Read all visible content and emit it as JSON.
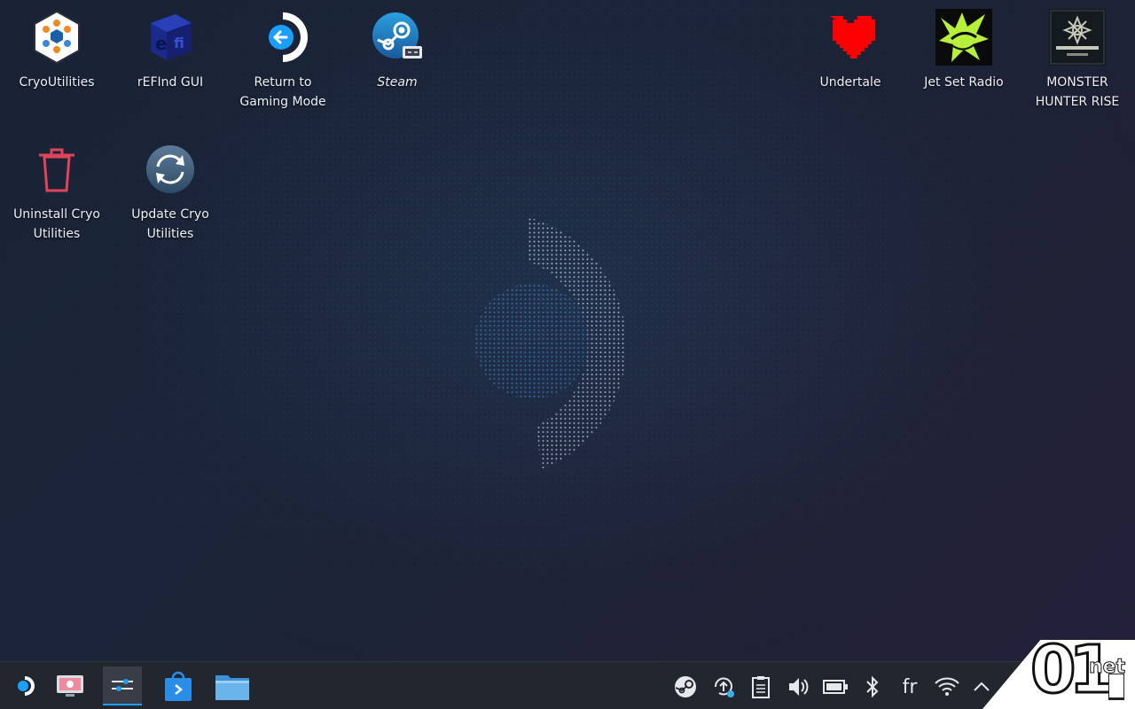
{
  "desktop": {
    "icons": [
      {
        "id": "cryoutilities",
        "label": "CryoUtilities",
        "icon": "cryoutilities-icon"
      },
      {
        "id": "refind",
        "label": "rEFInd GUI",
        "icon": "refind-icon"
      },
      {
        "id": "return-gaming",
        "label": "Return to Gaming Mode",
        "icon": "return-arrow-icon"
      },
      {
        "id": "steam",
        "label": "Steam",
        "icon": "steam-icon"
      },
      {
        "id": "undertale",
        "label": "Undertale",
        "icon": "heart-icon"
      },
      {
        "id": "jetsetradio",
        "label": "Jet Set Radio",
        "icon": "jet-set-radio-icon"
      },
      {
        "id": "mhrise",
        "label": "MONSTER HUNTER RISE",
        "icon": "monster-hunter-icon"
      },
      {
        "id": "uninstall-cryo",
        "label": "Uninstall Cryo Utilities",
        "icon": "trash-icon"
      },
      {
        "id": "update-cryo",
        "label": "Update Cryo Utilities",
        "icon": "refresh-icon"
      }
    ]
  },
  "taskbar": {
    "launcher_icon": "steamos-launcher-icon",
    "apps": [
      "system-info-icon",
      "settings-icon",
      "discover-store-icon",
      "file-manager-icon"
    ],
    "tray": [
      "steam-tray-icon",
      "update-icon",
      "clipboard-icon",
      "volume-icon",
      "battery-icon",
      "bluetooth-icon",
      "wifi-icon",
      "expand-tray-icon"
    ],
    "language": "fr"
  },
  "watermark": {
    "number": "01",
    "suffix": "net"
  },
  "colors": {
    "desktop": "#1b2438",
    "taskbar": "#22262e",
    "accent": "#1a9fff"
  }
}
